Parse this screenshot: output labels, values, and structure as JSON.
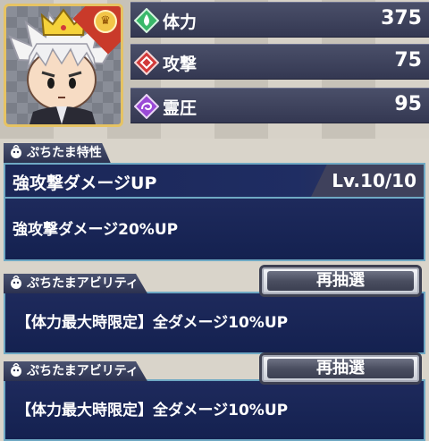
{
  "stats": [
    {
      "label": "体力",
      "value": "375",
      "icon": "hp-green-diamond-icon",
      "color": "#3ab86a"
    },
    {
      "label": "攻撃",
      "value": "75",
      "icon": "attack-red-diamond-icon",
      "color": "#d23a3a"
    },
    {
      "label": "霊圧",
      "value": "95",
      "icon": "reiatsu-purple-diamond-icon",
      "color": "#9a4ad6"
    }
  ],
  "trait": {
    "tab_label": "ぷちたま特性",
    "name": "強攻撃ダメージUP",
    "level": "Lv.10/10",
    "description": "強攻撃ダメージ20%UP"
  },
  "abilities": [
    {
      "tab_label": "ぷちたまアビリティ",
      "reroll_label": "再抽選",
      "description": "【体力最大時限定】全ダメージ10%UP"
    },
    {
      "tab_label": "ぷちたまアビリティ",
      "reroll_label": "再抽選",
      "description": "【体力最大時限定】全ダメージ10%UP"
    }
  ],
  "colors": {
    "panel_bg": "#1e2a5c",
    "panel_border": "#6fa9c4",
    "portrait_frame": "#e6c363"
  }
}
